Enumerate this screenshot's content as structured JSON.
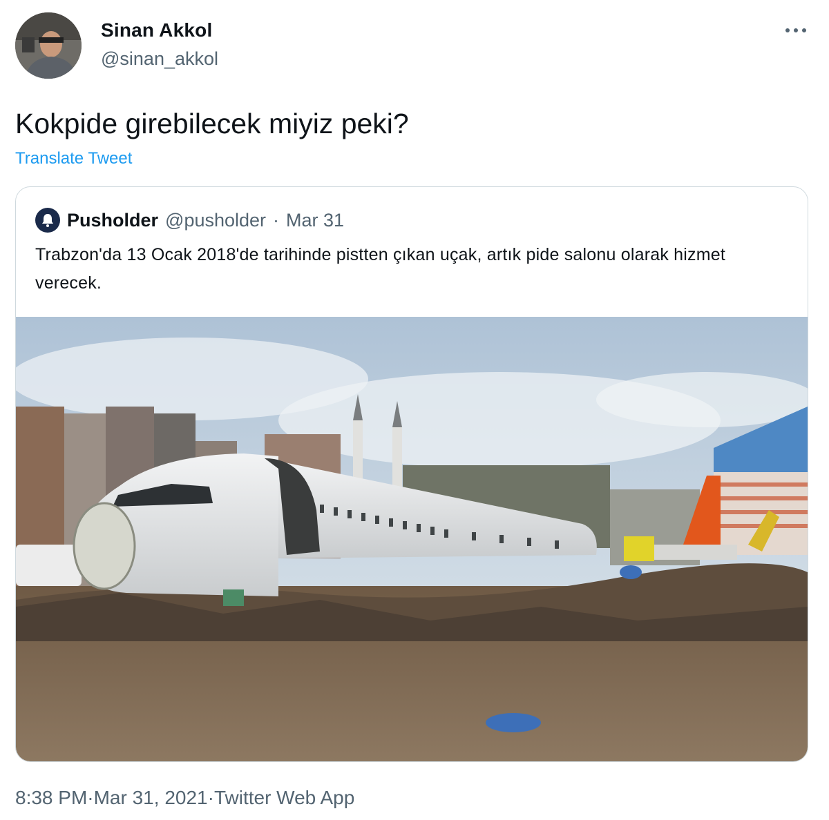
{
  "author": {
    "name": "Sinan Akkol",
    "handle": "@sinan_akkol"
  },
  "tweet": {
    "text": "Kokpide girebilecek miyiz peki?",
    "translate_label": "Translate Tweet"
  },
  "quoted": {
    "name": "Pusholder",
    "handle": "@pusholder",
    "separator": "·",
    "date": "Mar 31",
    "text": "Trabzon'da 13 Ocak 2018'de tarihinde pistten çıkan uçak, artık pide salonu olarak hizmet verecek."
  },
  "footer": {
    "time": "8:38 PM",
    "separator": " · ",
    "date": "Mar 31, 2021",
    "source": "Twitter Web App"
  },
  "icons": {
    "more": "more-horizontal-icon",
    "quoted_avatar": "pusholder-logo-icon"
  },
  "colors": {
    "link": "#1d9bf0",
    "secondary_text": "#536471",
    "card_border": "#cfd9de"
  }
}
